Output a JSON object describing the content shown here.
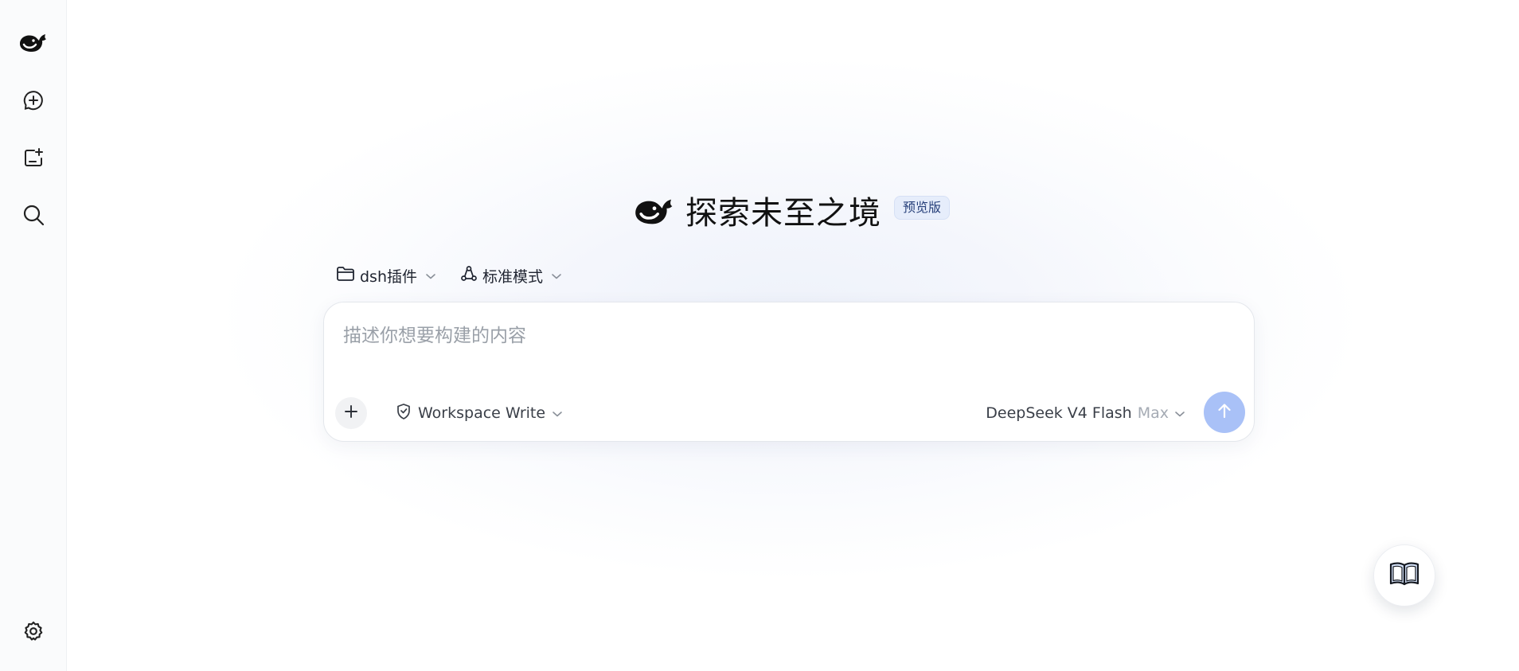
{
  "hero": {
    "title": "探索未至之境",
    "badge": "预览版"
  },
  "toolbar": {
    "project_label": "dsh插件",
    "mode_label": "标准模式"
  },
  "composer": {
    "placeholder": "描述你想要构建的内容",
    "value": "",
    "permission_label": "Workspace Write",
    "model_name": "DeepSeek V4 Flash",
    "model_level": "Max"
  },
  "icons": {
    "sidebar": [
      "whale-logo-icon",
      "new-chat-icon",
      "new-project-icon",
      "search-icon",
      "settings-icon"
    ],
    "toolbar": [
      "folder-icon",
      "chevron-down-icon",
      "mode-icon",
      "chevron-down-icon"
    ],
    "composer": [
      "plus-icon",
      "shield-icon",
      "chevron-down-icon",
      "arrow-up-icon"
    ],
    "fab": "book-icon"
  },
  "colors": {
    "send_button": "#a9c1f7",
    "badge_bg": "#e6edfb",
    "badge_text": "#27407a"
  }
}
